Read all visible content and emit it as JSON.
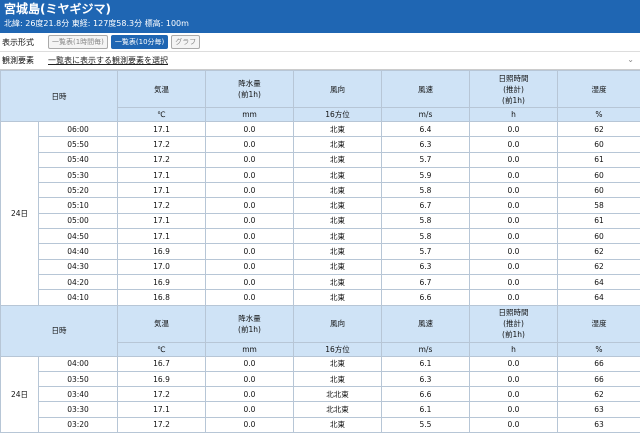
{
  "station": {
    "title": "宮城島(ミヤギジマ)",
    "info": "北緯: 26度21.8分 東経: 127度58.3分 標高: 100m"
  },
  "display": {
    "label": "表示形式",
    "buttons": [
      "一覧表(1時間毎)",
      "一覧表(10分毎)",
      "グラフ"
    ]
  },
  "elements": {
    "label": "観測要素",
    "select_text": "一覧表に表示する観測要素を選択"
  },
  "table": {
    "headers": [
      "日時",
      "気温",
      "降水量\n(前1h)",
      "風向",
      "風速",
      "日照時間\n(推計)\n(前1h)",
      "湿度"
    ],
    "units": [
      "",
      "℃",
      "mm",
      "16方位",
      "m/s",
      "h",
      "%"
    ],
    "day": "24日",
    "block1": [
      [
        "06:00",
        "17.1",
        "0.0",
        "北東",
        "6.4",
        "0.0",
        "62"
      ],
      [
        "05:50",
        "17.2",
        "0.0",
        "北東",
        "6.3",
        "0.0",
        "60"
      ],
      [
        "05:40",
        "17.2",
        "0.0",
        "北東",
        "5.7",
        "0.0",
        "61"
      ],
      [
        "05:30",
        "17.1",
        "0.0",
        "北東",
        "5.9",
        "0.0",
        "60"
      ],
      [
        "05:20",
        "17.1",
        "0.0",
        "北東",
        "5.8",
        "0.0",
        "60"
      ],
      [
        "05:10",
        "17.2",
        "0.0",
        "北東",
        "6.7",
        "0.0",
        "58"
      ],
      [
        "05:00",
        "17.1",
        "0.0",
        "北東",
        "5.8",
        "0.0",
        "61"
      ],
      [
        "04:50",
        "17.1",
        "0.0",
        "北東",
        "5.8",
        "0.0",
        "60"
      ],
      [
        "04:40",
        "16.9",
        "0.0",
        "北東",
        "5.7",
        "0.0",
        "62"
      ],
      [
        "04:30",
        "17.0",
        "0.0",
        "北東",
        "6.3",
        "0.0",
        "62"
      ],
      [
        "04:20",
        "16.9",
        "0.0",
        "北東",
        "6.7",
        "0.0",
        "64"
      ],
      [
        "04:10",
        "16.8",
        "0.0",
        "北東",
        "6.6",
        "0.0",
        "64"
      ]
    ],
    "block2": [
      [
        "04:00",
        "16.7",
        "0.0",
        "北東",
        "6.1",
        "0.0",
        "66"
      ],
      [
        "03:50",
        "16.9",
        "0.0",
        "北東",
        "6.3",
        "0.0",
        "66"
      ],
      [
        "03:40",
        "17.2",
        "0.0",
        "北北東",
        "6.6",
        "0.0",
        "62"
      ],
      [
        "03:30",
        "17.1",
        "0.0",
        "北北東",
        "6.1",
        "0.0",
        "63"
      ],
      [
        "03:20",
        "17.2",
        "0.0",
        "北東",
        "5.5",
        "0.0",
        "63"
      ]
    ]
  }
}
